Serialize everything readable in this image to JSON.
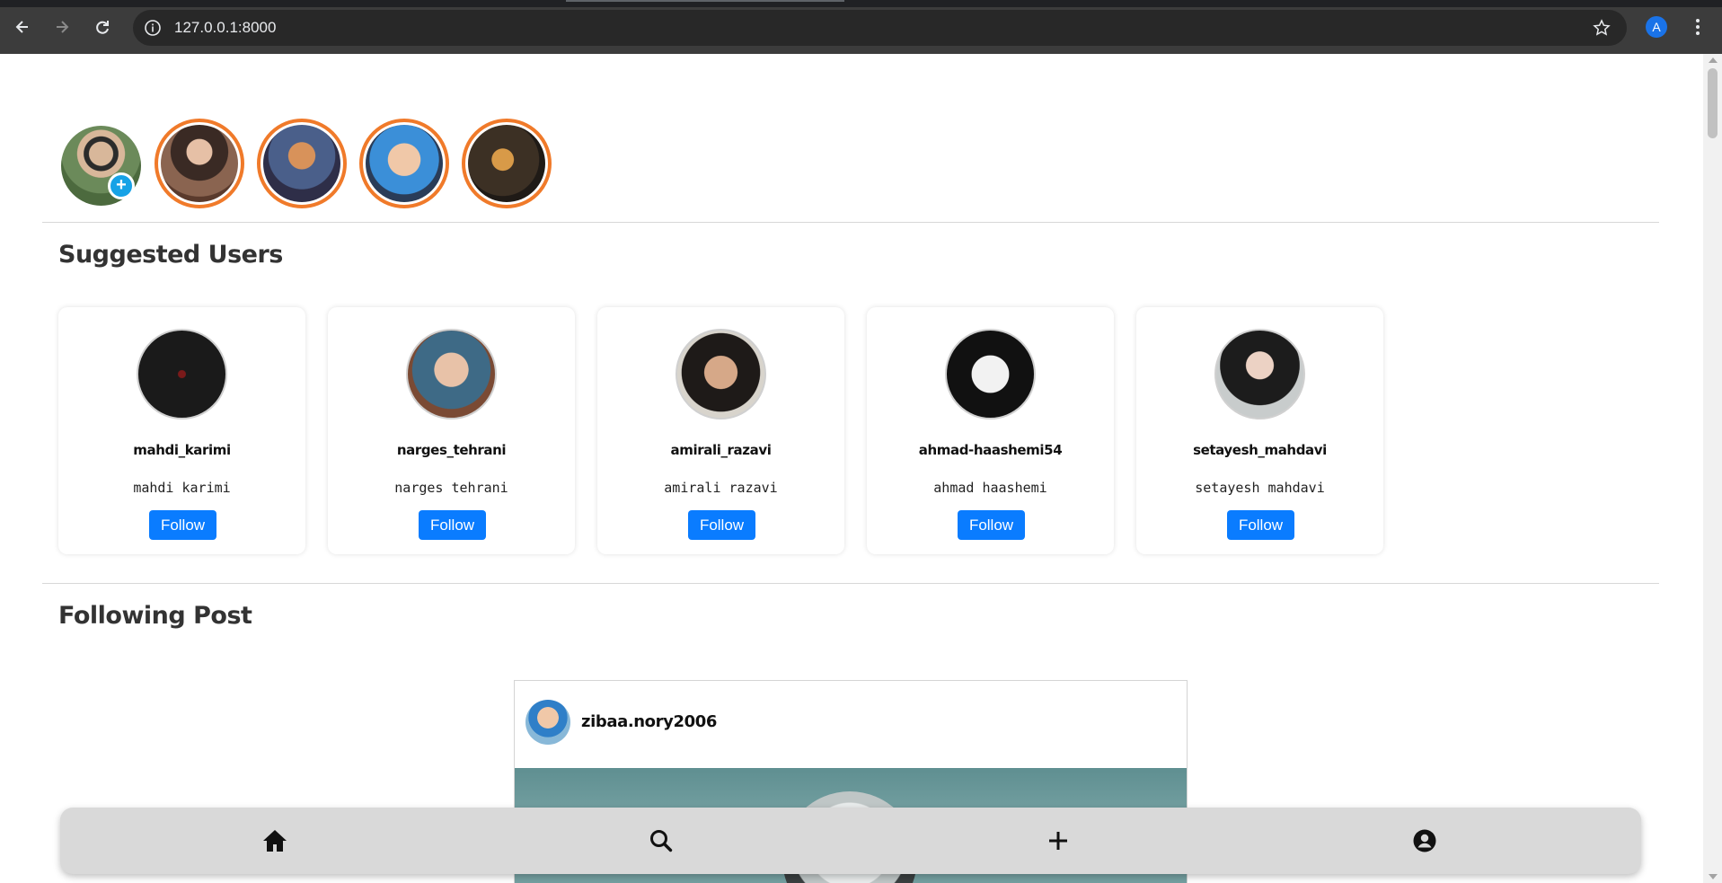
{
  "browser": {
    "url": "127.0.0.1:8000",
    "profile_initial": "A",
    "colors": {
      "chrome": "#3c3c3c",
      "omnibox": "#282828"
    }
  },
  "stories": {
    "own_story_icon": "plus-icon",
    "items": [
      {
        "name": "story-1",
        "colors": [
          "#3a2a24",
          "#c8a38a",
          "#6b4a3a"
        ]
      },
      {
        "name": "story-2",
        "colors": [
          "#4a5f8a",
          "#d8925a",
          "#2e2e48"
        ]
      },
      {
        "name": "story-3",
        "colors": [
          "#3b8fd8",
          "#f0c8a8",
          "#2a3c58"
        ]
      },
      {
        "name": "story-4",
        "colors": [
          "#3c3024",
          "#d89a48",
          "#1f1a16"
        ]
      }
    ]
  },
  "suggested": {
    "title": "Suggested Users",
    "follow_label": "Follow",
    "users": [
      {
        "username": "mahdi_karimi",
        "full_name": "mahdi karimi"
      },
      {
        "username": "narges_tehrani",
        "full_name": "narges tehrani"
      },
      {
        "username": "amirali_razavi",
        "full_name": "amirali razavi"
      },
      {
        "username": "ahmad-haashemi54",
        "full_name": "ahmad haashemi"
      },
      {
        "username": "setayesh_mahdavi",
        "full_name": "setayesh mahdavi"
      }
    ]
  },
  "following": {
    "title": "Following Post",
    "post": {
      "username": "zibaa.nory2006"
    }
  },
  "bottom_nav": {
    "items": [
      "home-icon",
      "search-icon",
      "plus-icon",
      "profile-icon"
    ]
  },
  "accent_colors": {
    "follow_button": "#0a7cff",
    "story_ring": "#f07a2a",
    "add_badge": "#17a2e6"
  }
}
